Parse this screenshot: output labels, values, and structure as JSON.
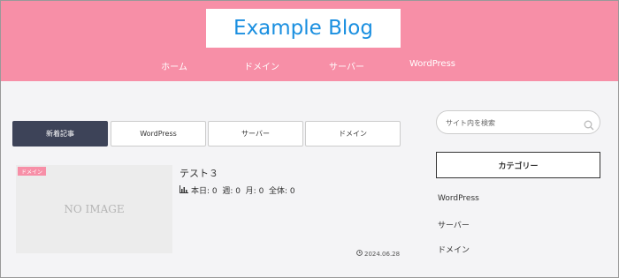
{
  "header": {
    "logo_text": "Example Blog",
    "nav": [
      "ホーム",
      "ドメイン",
      "サーバー",
      "WordPress"
    ]
  },
  "tabs": [
    "新着記事",
    "WordPress",
    "サーバー",
    "ドメイン"
  ],
  "post": {
    "category_badge": "ドメイン",
    "no_image_text": "NO IMAGE",
    "title": "テスト３",
    "stats": "本日: 0  週: 0  月: 0  全体: 0",
    "date": "2024.06.28"
  },
  "sidebar": {
    "search_placeholder": "サイト内を検索",
    "category_heading": "カテゴリー",
    "categories": [
      "WordPress",
      "サーバー",
      "ドメイン"
    ]
  },
  "colors": {
    "header_bg": "#f78fa7",
    "logo_text": "#1a8fe0",
    "active_tab": "#3d4358"
  }
}
